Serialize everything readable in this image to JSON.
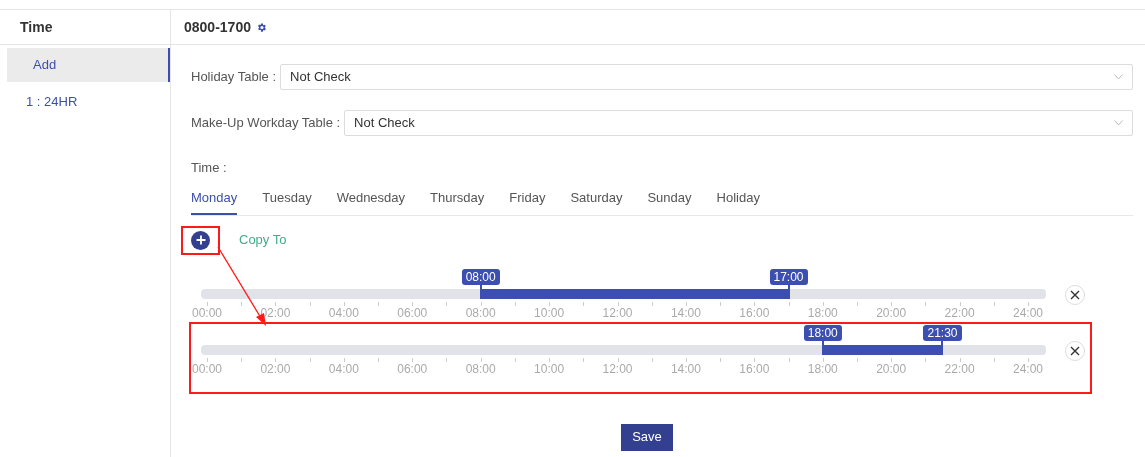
{
  "sidebar": {
    "title": "Time",
    "items": [
      {
        "label": "Add",
        "selected": true
      },
      {
        "label": "1 : 24HR",
        "selected": false
      }
    ]
  },
  "header": {
    "title": "0800-1700"
  },
  "fields": [
    {
      "label": "Holiday Table :",
      "value": "Not Check"
    },
    {
      "label": "Make-Up Workday Table :",
      "value": "Not Check"
    }
  ],
  "time_label": "Time :",
  "tabs": [
    {
      "label": "Monday",
      "selected": true
    },
    {
      "label": "Tuesday",
      "selected": false
    },
    {
      "label": "Wednesday",
      "selected": false
    },
    {
      "label": "Thursday",
      "selected": false
    },
    {
      "label": "Friday",
      "selected": false
    },
    {
      "label": "Saturday",
      "selected": false
    },
    {
      "label": "Sunday",
      "selected": false
    },
    {
      "label": "Holiday",
      "selected": false
    }
  ],
  "copy_to": "Copy To",
  "timelines": [
    {
      "start": "08:00",
      "end": "17:00",
      "highlighted": false,
      "scale": [
        "00:00",
        "02:00",
        "04:00",
        "06:00",
        "08:00",
        "10:00",
        "12:00",
        "14:00",
        "16:00",
        "18:00",
        "20:00",
        "22:00",
        "24:00"
      ]
    },
    {
      "start": "18:00",
      "end": "21:30",
      "highlighted": true,
      "scale": [
        "00:00",
        "02:00",
        "04:00",
        "06:00",
        "08:00",
        "10:00",
        "12:00",
        "14:00",
        "16:00",
        "18:00",
        "20:00",
        "22:00",
        "24:00"
      ]
    }
  ],
  "save": "Save"
}
